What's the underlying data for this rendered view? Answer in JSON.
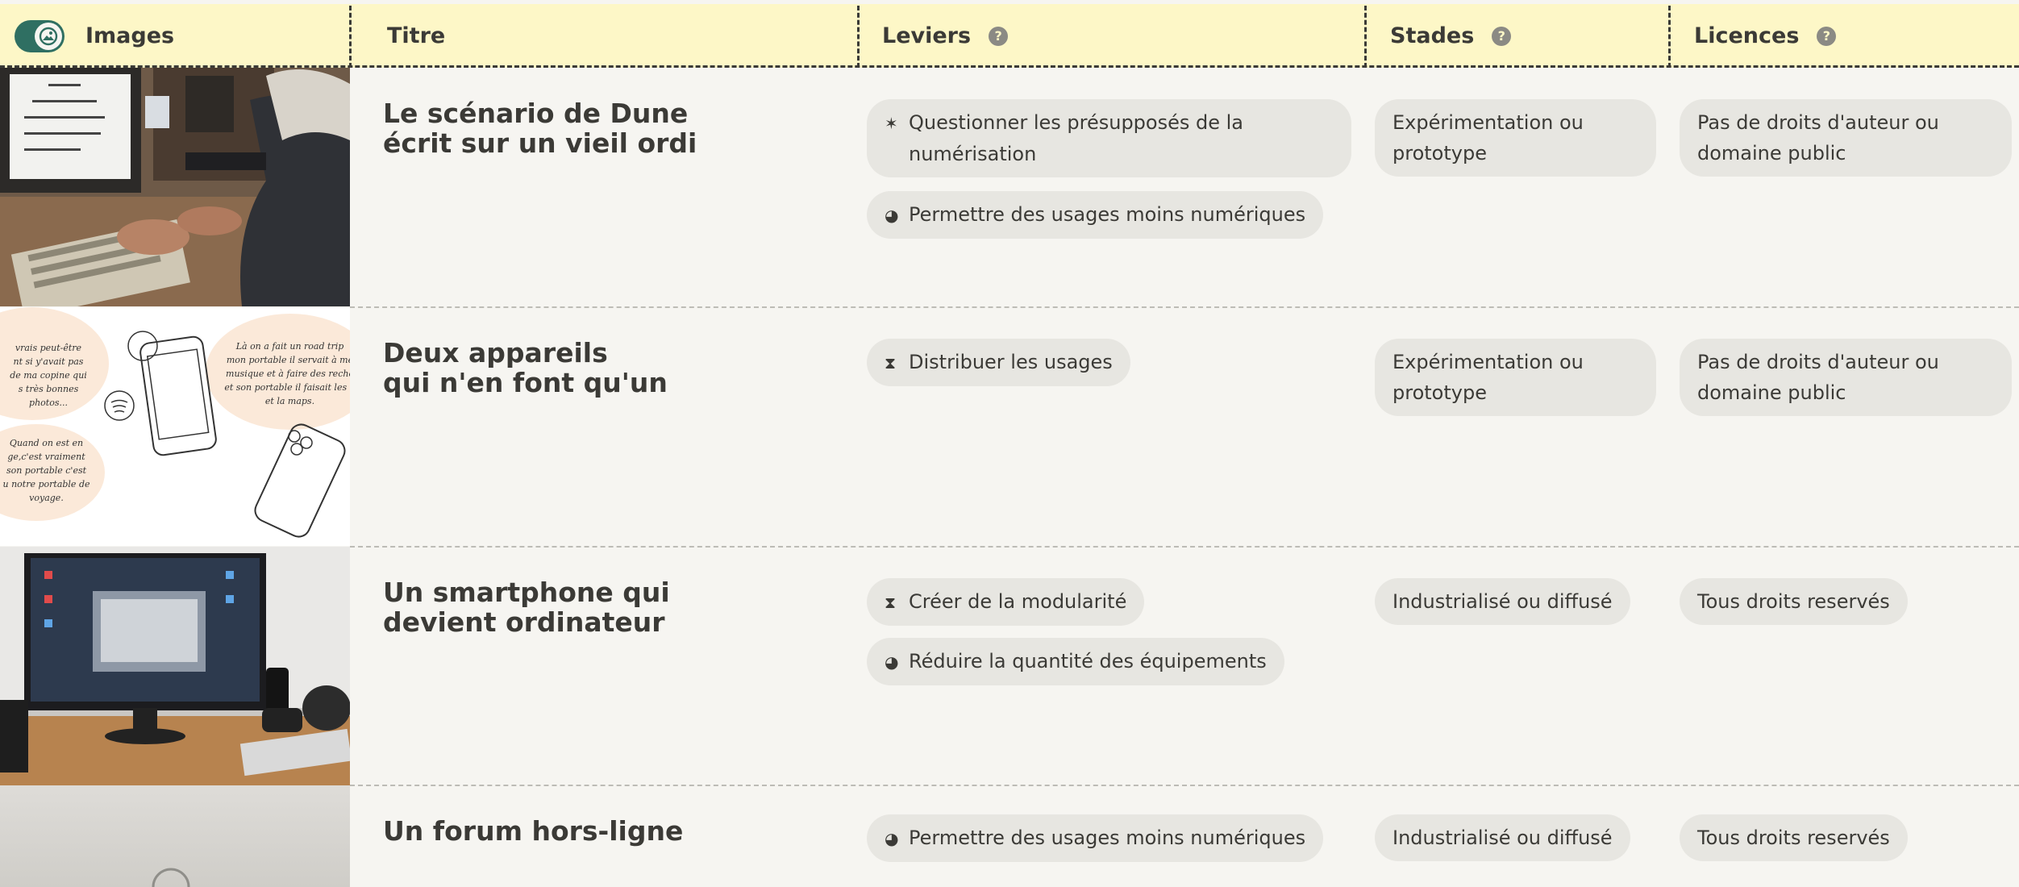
{
  "header": {
    "images": "Images",
    "titre": "Titre",
    "leviers": "Leviers",
    "stades": "Stades",
    "licences": "Licences",
    "help": "?"
  },
  "rows": [
    {
      "title_l1": "Le scénario de Dune",
      "title_l2": "écrit sur un vieil ordi",
      "levers": [
        {
          "sym": "✶",
          "l1": "Questionner les présupposés de la",
          "l2": "numérisation"
        },
        {
          "sym": "◕",
          "l1": "Permettre des usages moins numériques"
        }
      ],
      "stade_l1": "Expérimentation ou",
      "stade_l2": "prototype",
      "licence_l1": "Pas de droits d'auteur ou",
      "licence_l2": "domaine public"
    },
    {
      "title_l1": "Deux appareils",
      "title_l2": "qui n'en font qu'un",
      "levers": [
        {
          "sym": "⧗",
          "l1": "Distribuer les usages"
        }
      ],
      "stade_l1": "Expérimentation ou",
      "stade_l2": "prototype",
      "licence_l1": "Pas de droits d'auteur ou",
      "licence_l2": "domaine public",
      "illustration_text": {
        "left_top": [
          "vrais peut-être",
          "nt si y'avait pas",
          "de ma copine qui",
          "s très bonnes",
          "photos..."
        ],
        "left_bottom": [
          "Quand on est en",
          "ge,c'est vraiment",
          "son portable c'est",
          "u notre portable de",
          "voyage."
        ],
        "right": [
          "Là on a fait un road trip",
          "mon portable il servait à me",
          "musique et à faire des reche",
          "et son portable il faisait les p",
          "et la maps."
        ]
      }
    },
    {
      "title_l1": "Un smartphone qui",
      "title_l2": "devient ordinateur",
      "levers": [
        {
          "sym": "⧗",
          "l1": "Créer de la modularité"
        },
        {
          "sym": "◕",
          "l1": "Réduire la quantité des équipements"
        }
      ],
      "stade_l1": "Industrialisé ou diffusé",
      "licence_l1": "Tous droits reservés"
    },
    {
      "title_l1": "Un forum hors-ligne",
      "levers": [
        {
          "sym": "◕",
          "l1": "Permettre des usages moins numériques"
        }
      ],
      "stade_l1": "Industrialisé ou diffusé",
      "licence_l1": "Tous droits reservés"
    }
  ]
}
